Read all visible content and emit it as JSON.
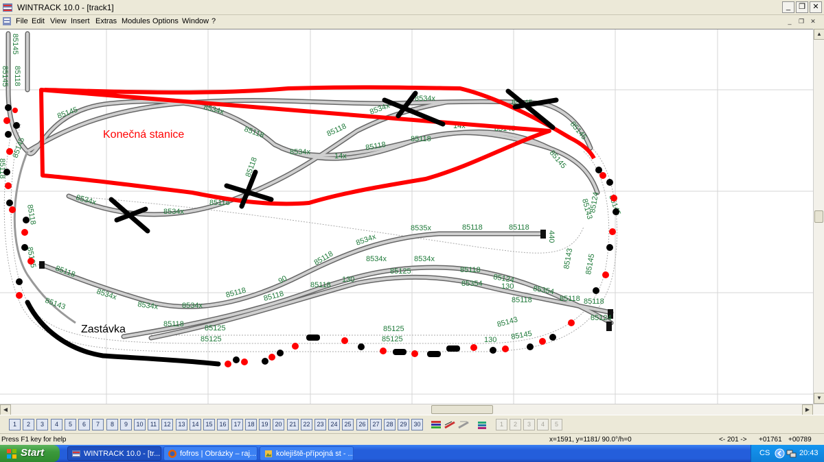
{
  "window": {
    "title": "WINTRACK 10.0 - [track1]",
    "minimize_glyph": "_",
    "restore_glyph": "❐",
    "close_glyph": "✕",
    "mdi_minimize_glyph": "_",
    "mdi_restore_glyph": "❐",
    "mdi_close_glyph": "✕"
  },
  "menu": {
    "items": [
      "File",
      "Edit",
      "View",
      "Insert",
      "Extras",
      "Modules",
      "Options",
      "Window",
      "?"
    ]
  },
  "canvas": {
    "annotations": {
      "station_label": "Konečná stanice",
      "stop_label": "Zastávka"
    },
    "track_labels": [
      "85145",
      "8534x",
      "85118",
      "8534x",
      "8534x",
      "85145",
      "85118",
      "85118",
      "8534x",
      "14x",
      "85145",
      "85118",
      "85118",
      "14x",
      "85145",
      "85143",
      "85124",
      "85143",
      "85145",
      "8534x",
      "85118",
      "85118",
      "8534x",
      "8535x",
      "85118",
      "85118",
      "440",
      "8534x",
      "85118",
      "85118",
      "8534x",
      "8534x",
      "8534x",
      "85118",
      "90",
      "85118",
      "85118",
      "130",
      "85125",
      "8534x",
      "85118",
      "85124",
      "85354",
      "130",
      "85118",
      "85118",
      "85124",
      "85143",
      "85118",
      "85125",
      "85125",
      "85125",
      "85143",
      "130",
      "85145",
      "85145",
      "85118",
      "85125",
      "85145",
      "85118",
      "85145",
      "85118",
      "85118",
      "85145"
    ]
  },
  "scroll": {
    "up_glyph": "▲",
    "down_glyph": "▼",
    "left_glyph": "◀",
    "right_glyph": "▶"
  },
  "toolbar": {
    "modules": [
      "1",
      "2",
      "3",
      "4",
      "5",
      "6",
      "7",
      "8",
      "9",
      "10",
      "11",
      "12",
      "13",
      "14",
      "15",
      "16",
      "17",
      "18",
      "19",
      "20",
      "21",
      "22",
      "23",
      "24",
      "25",
      "26",
      "27",
      "28",
      "29",
      "30"
    ],
    "gray_modules": [
      "1",
      "2",
      "3",
      "4",
      "5"
    ]
  },
  "status": {
    "help": "Press F1 key for help",
    "coords": "x=1591, y=1181/ 90.0°/h=0",
    "page": "<- 201 ->",
    "x_value": "+01761",
    "y_value": "+00789"
  },
  "taskbar": {
    "start_label": "Start",
    "buttons": [
      {
        "label": "WINTRACK 10.0 - [tr..."
      },
      {
        "label": "fofros | Obrázky – raj..."
      },
      {
        "label": "kolejiště-přípojná st - ..."
      }
    ],
    "tray_lang": "CS",
    "tray_time": "20:43"
  },
  "colors": {
    "track_fill": "#c8c8c8",
    "track_edge": "#555555",
    "label_green": "#1f7a3a",
    "annotation_red": "#ff0000",
    "annotation_black": "#000000",
    "taskbar_blue": "#245edb",
    "start_green": "#3c9a3c"
  }
}
